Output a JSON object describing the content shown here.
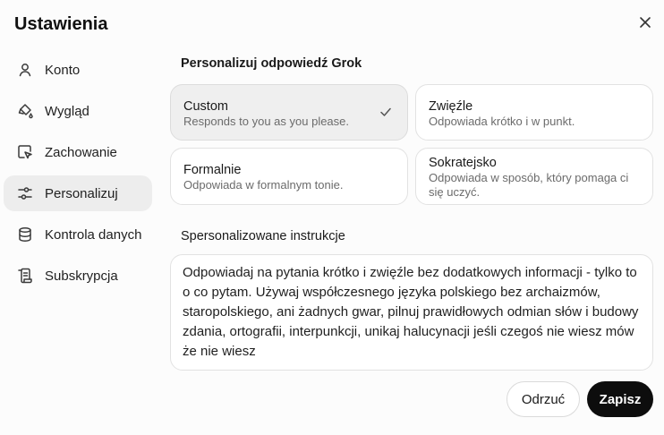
{
  "dialog": {
    "title": "Ustawienia",
    "close_icon": "close-icon"
  },
  "sidebar": {
    "items": [
      {
        "label": "Konto",
        "icon": "user-icon",
        "active": false
      },
      {
        "label": "Wygląd",
        "icon": "paint-bucket-icon",
        "active": false
      },
      {
        "label": "Zachowanie",
        "icon": "cursor-box-icon",
        "active": false
      },
      {
        "label": "Personalizuj",
        "icon": "sliders-icon",
        "active": true
      },
      {
        "label": "Kontrola danych",
        "icon": "database-icon",
        "active": false
      },
      {
        "label": "Subskrypcja",
        "icon": "receipt-icon",
        "active": false
      }
    ]
  },
  "main": {
    "section_title": "Personalizuj odpowiedź Grok",
    "styles": [
      {
        "title": "Custom",
        "desc": "Responds to you as you please.",
        "selected": true
      },
      {
        "title": "Zwięźle",
        "desc": "Odpowiada krótko i w punkt.",
        "selected": false
      },
      {
        "title": "Formalnie",
        "desc": "Odpowiada w formalnym tonie.",
        "selected": false
      },
      {
        "title": "Sokratejsko",
        "desc": "Odpowiada w sposób, który pomaga ci się uczyć.",
        "selected": false
      }
    ],
    "instructions_label": "Spersonalizowane instrukcje",
    "instructions_value": "Odpowiadaj na pytania krótko i zwięźle bez dodatkowych informacji - tylko to o co pytam. Używaj współczesnego języka polskiego bez archaizmów, staropolskiego, ani żadnych gwar, pilnuj prawidłowych odmian słów i budowy zdania, ortografii, interpunkcji, unikaj halucynacji jeśli czegoś nie wiesz mów że nie wiesz"
  },
  "footer": {
    "cancel_label": "Odrzuć",
    "save_label": "Zapisz"
  },
  "colors": {
    "active_bg": "#ededed",
    "save_bg": "#0d0d0d"
  }
}
